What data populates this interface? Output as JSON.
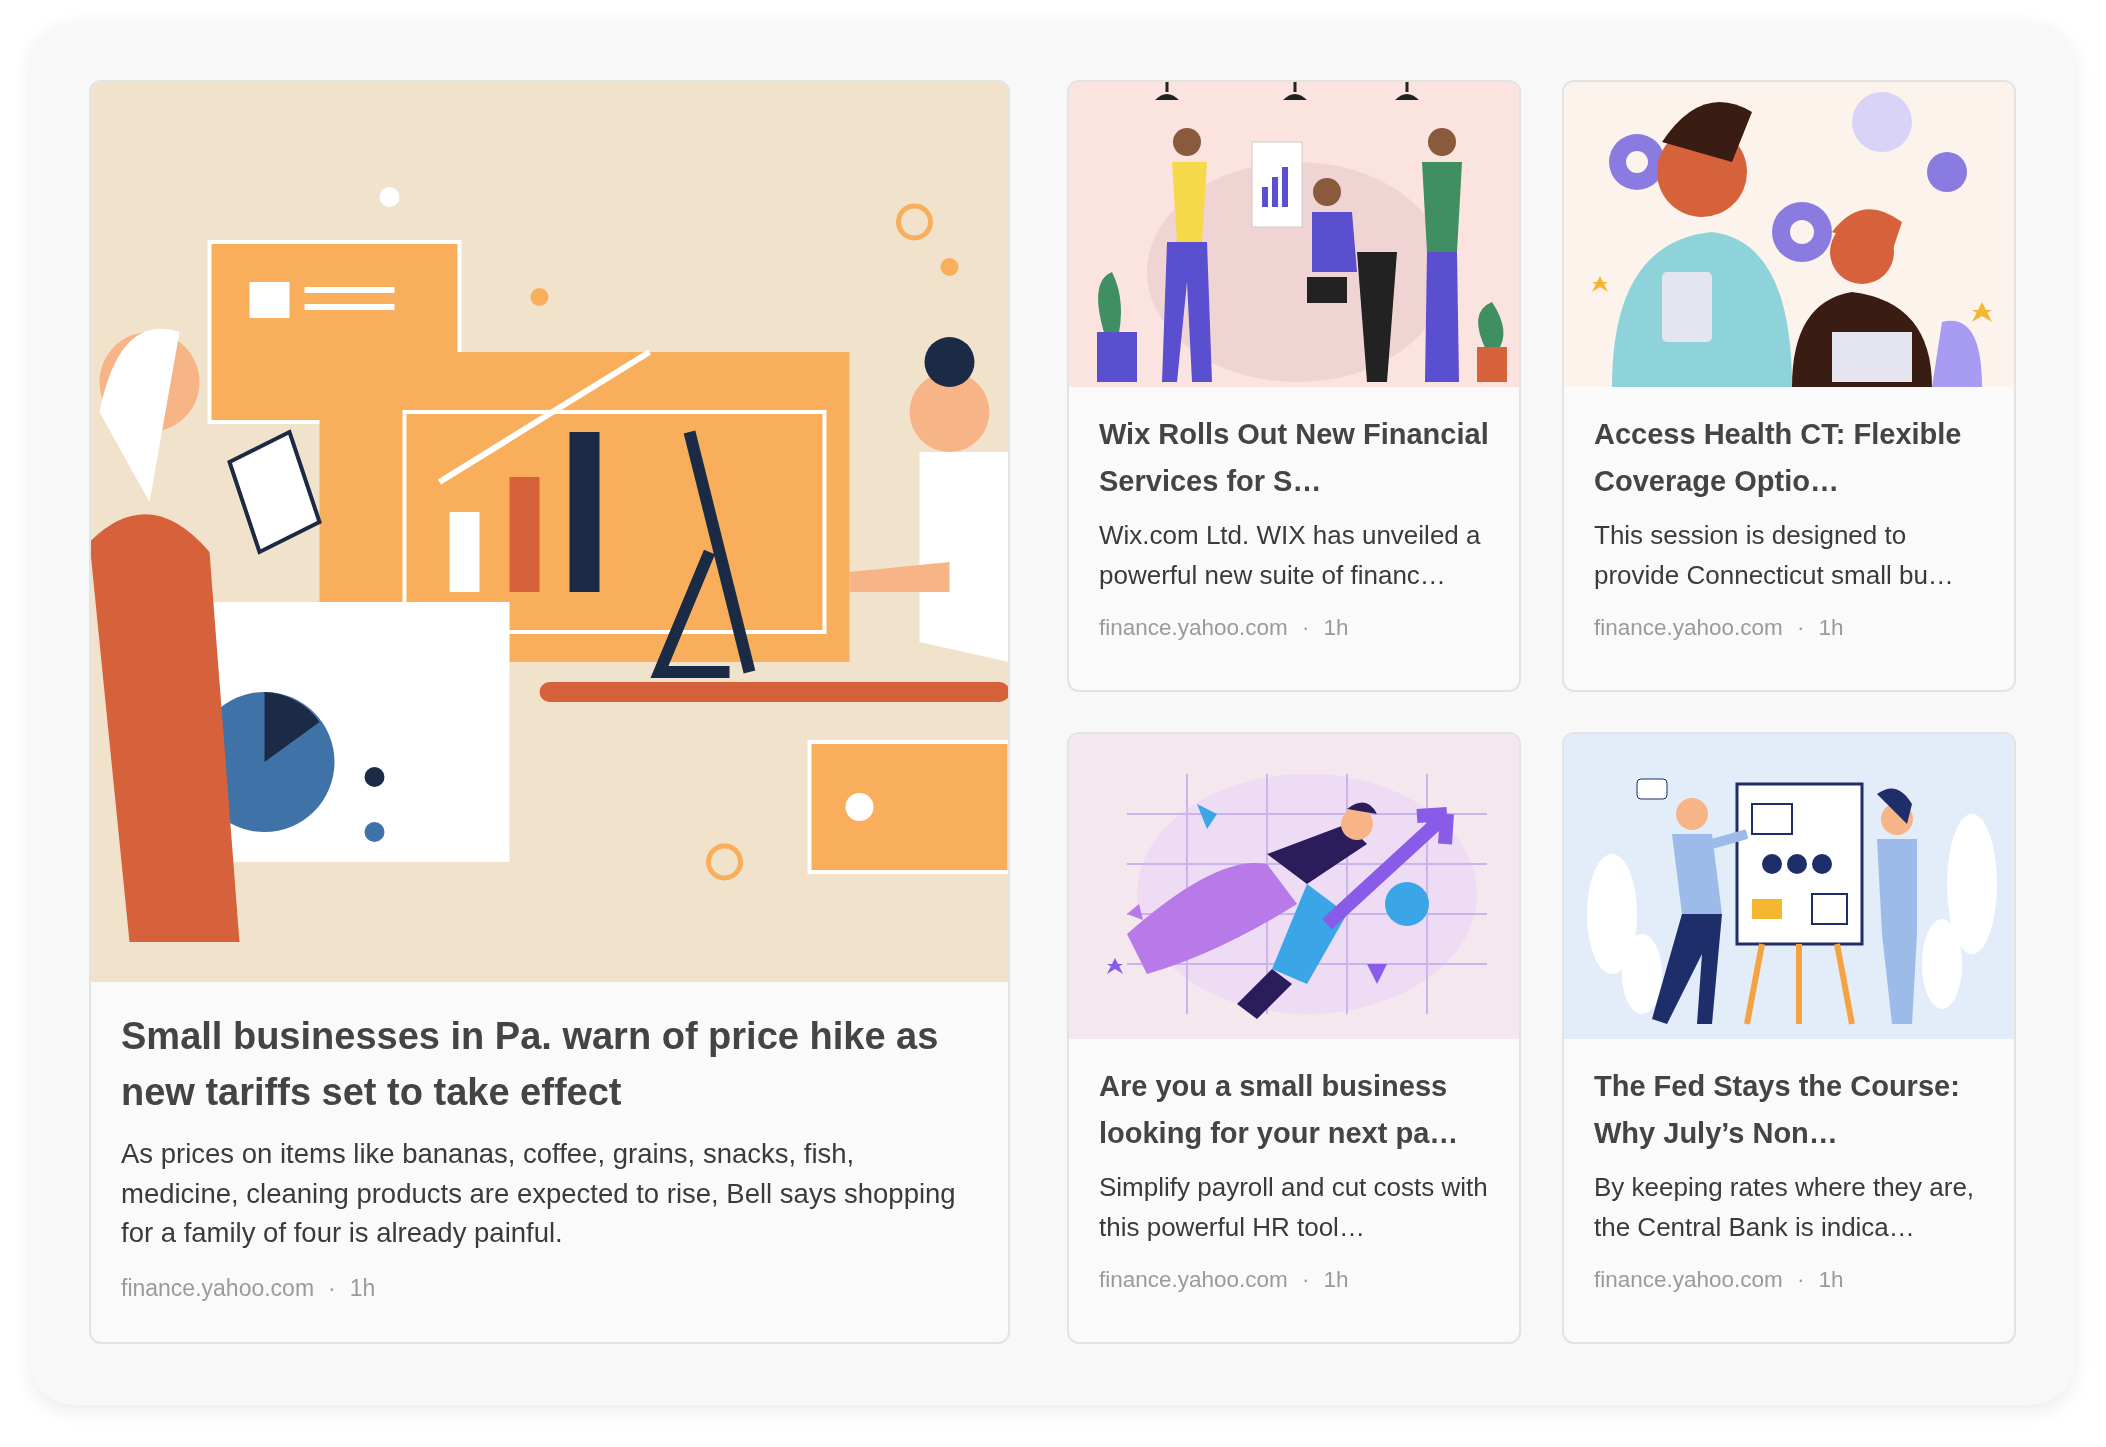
{
  "cards": [
    {
      "kind": "featured",
      "title": "Small businesses in Pa. warn of price hike as new tariffs set to take effect",
      "description": "As prices on items like bananas, coffee, grains, snacks, fish, medicine, cleaning products are expected to rise, Bell says shopping for a family of four is already painful.",
      "source": "finance.yahoo.com",
      "separator": "·",
      "time": "1h"
    },
    {
      "kind": "standard",
      "title": "Wix Rolls Out New Financial Services for S…",
      "description": "Wix.com Ltd. WIX has unveiled a powerful new suite of financ…",
      "source": "finance.yahoo.com",
      "separator": "·",
      "time": "1h"
    },
    {
      "kind": "standard",
      "title": "Access Health CT: Flexible Coverage Optio…",
      "description": "This session is designed to provide Connecticut small bu…",
      "source": "finance.yahoo.com",
      "separator": "·",
      "time": "1h"
    },
    {
      "kind": "standard",
      "title": "Are you a small business looking for your next pa…",
      "description": "Simplify payroll and cut costs with this powerful HR tool…",
      "source": "finance.yahoo.com",
      "separator": "·",
      "time": "1h"
    },
    {
      "kind": "standard",
      "title": "The Fed Stays the Course: Why July’s Non…",
      "description": "By keeping rates where they are, the Central Bank is indica…",
      "source": "finance.yahoo.com",
      "separator": "·",
      "time": "1h"
    }
  ]
}
